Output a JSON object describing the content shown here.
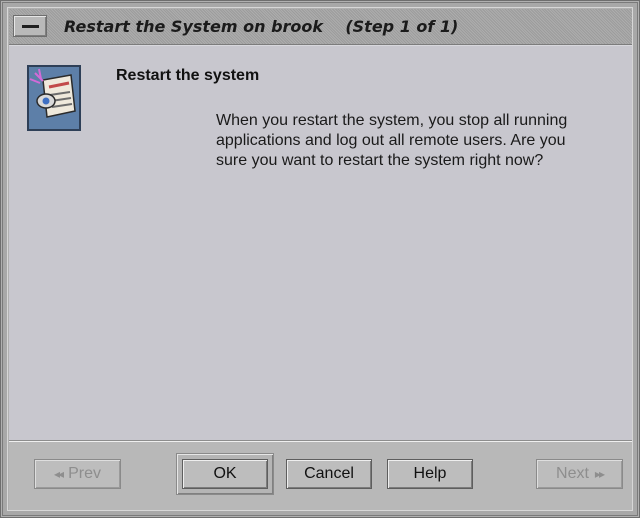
{
  "window": {
    "title": "Restart the System on brook    (Step 1 of 1)"
  },
  "content": {
    "heading": "Restart the system",
    "message": "When you restart the system, you stop all running applications and log out all remote users. Are you sure you want to restart the system right now?",
    "icon": "restart-system-document-icon"
  },
  "buttons": {
    "prev": "Prev",
    "ok": "OK",
    "cancel": "Cancel",
    "help": "Help",
    "next": "Next"
  },
  "icons": {
    "prev_arrow": "◂◂",
    "next_arrow": "▸▸"
  },
  "colors": {
    "content_bg": "#c8c7ce",
    "footer_bg": "#b8b8b8",
    "disabled_text": "#8e8e8e"
  }
}
